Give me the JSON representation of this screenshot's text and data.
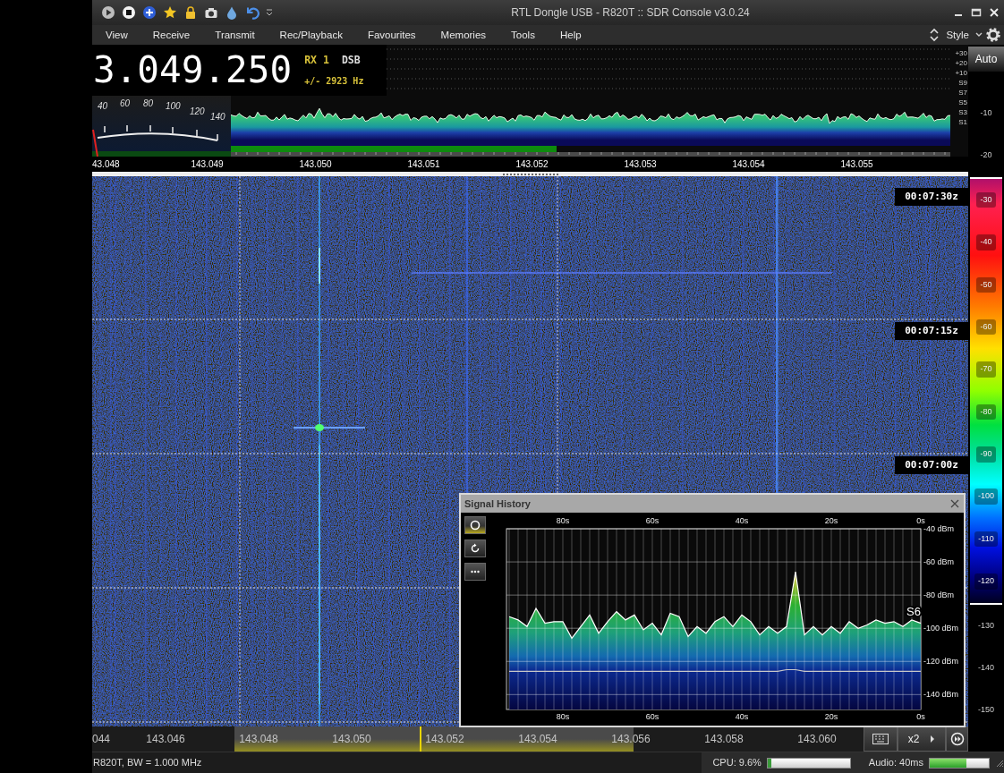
{
  "title_bar": {
    "title": "RTL Dongle USB - R820T :: SDR Console v3.0.24"
  },
  "menu": [
    "View",
    "Receive",
    "Transmit",
    "Rec/Playback",
    "Favourites",
    "Memories",
    "Tools",
    "Help"
  ],
  "style_menu": "Style",
  "frequency": {
    "value": "3.049.250",
    "receiver": "RX 1",
    "mode": "DSB",
    "bandwidth": "+/- 2923 Hz"
  },
  "s_meter": {
    "scale": [
      "40",
      "60",
      "80",
      "100",
      "120",
      "140"
    ]
  },
  "spectrum": {
    "scale_labels": [
      "+30",
      "+20",
      "+10",
      "S9",
      "S7",
      "S5",
      "S3",
      "S1"
    ]
  },
  "auto_button": "Auto",
  "frequency_axis": [
    "43.048",
    "143.049",
    "143.050",
    "143.051",
    "143.052",
    "143.053",
    "143.054",
    "143.055"
  ],
  "level_scale": [
    {
      "label": "-10",
      "kind": "plain"
    },
    {
      "label": "-20",
      "kind": "plain"
    },
    {
      "label": "-30",
      "kind": "band"
    },
    {
      "label": "-40",
      "kind": "band"
    },
    {
      "label": "-50",
      "kind": "band"
    },
    {
      "label": "-60",
      "kind": "band"
    },
    {
      "label": "-70",
      "kind": "band"
    },
    {
      "label": "-80",
      "kind": "band"
    },
    {
      "label": "-90",
      "kind": "band"
    },
    {
      "label": "-100",
      "kind": "band"
    },
    {
      "label": "-110",
      "kind": "band"
    },
    {
      "label": "-120",
      "kind": "band"
    },
    {
      "label": "-130",
      "kind": "plain"
    },
    {
      "label": "-140",
      "kind": "plain"
    },
    {
      "label": "-150",
      "kind": "plain"
    }
  ],
  "waterfall": {
    "time_marks": [
      "00:07:30z",
      "00:07:15z",
      "00:07:00z"
    ]
  },
  "signal_history": {
    "title": "Signal History",
    "level_label": "S6",
    "chart_data": {
      "type": "line",
      "grid": true,
      "x": [
        92,
        90,
        88,
        86,
        84,
        82,
        80,
        78,
        76,
        74,
        72,
        70,
        68,
        66,
        64,
        62,
        60,
        58,
        56,
        54,
        52,
        50,
        48,
        46,
        44,
        42,
        40,
        38,
        36,
        34,
        32,
        30,
        28,
        26,
        24,
        22,
        20,
        18,
        16,
        14,
        12,
        10,
        8,
        6,
        4,
        2,
        0
      ],
      "series": [
        {
          "color": "#ffffff",
          "values": [
            -93,
            -95,
            -99,
            -88,
            -97,
            -96,
            -96,
            -106,
            -99,
            -92,
            -103,
            -96,
            -90,
            -95,
            -92,
            -101,
            -97,
            -104,
            -91,
            -93,
            -105,
            -99,
            -103,
            -96,
            -93,
            -99,
            -92,
            -96,
            -104,
            -99,
            -103,
            -99,
            -66,
            -104,
            -99,
            -104,
            -99,
            -103,
            -96,
            -100,
            -98,
            -95,
            -97,
            -96,
            -99,
            -95,
            -97
          ]
        },
        {
          "color": "#c8c8c8",
          "values": [
            -126,
            -126,
            -126,
            -126,
            -126,
            -126,
            -126,
            -126,
            -126,
            -126,
            -126,
            -126,
            -126,
            -126,
            -126,
            -126,
            -126,
            -126,
            -126,
            -126,
            -126,
            -126,
            -126,
            -126,
            -126,
            -126,
            -126,
            -126,
            -126,
            -126,
            -126,
            -125,
            -125,
            -126,
            -126,
            -126,
            -126,
            -126,
            -126,
            -126,
            -126,
            -126,
            -126,
            -126,
            -126,
            -126,
            -126
          ]
        }
      ],
      "xlim": [
        92.6,
        0
      ],
      "ylim": [
        -149,
        -40
      ],
      "xticks": [
        {
          "value": 80,
          "label": "80s"
        },
        {
          "value": 60,
          "label": "60s"
        },
        {
          "value": 40,
          "label": "40s"
        },
        {
          "value": 20,
          "label": "20s"
        },
        {
          "value": 0,
          "label": "0s"
        }
      ],
      "yticks": [
        {
          "value": -40,
          "label": "-40 dBm"
        },
        {
          "value": -60,
          "label": "-60 dBm"
        },
        {
          "value": -80,
          "label": "-80 dBm"
        },
        {
          "value": -100,
          "label": "-100 dBm"
        },
        {
          "value": -120,
          "label": "-120 dBm"
        },
        {
          "value": -140,
          "label": "-140 dBm"
        }
      ]
    }
  },
  "overview_axis": [
    "044",
    "143.046",
    "143.048",
    "143.050",
    "143.052",
    "143.054",
    "143.056",
    "143.058",
    "143.060"
  ],
  "zoom_button": "x2",
  "status_bar": {
    "device": "R820T, BW = 1.000 MHz",
    "cpu": {
      "label": "CPU: 9.6%",
      "level": 0.04
    },
    "audio": {
      "label": "Audio: 40ms",
      "level": 0.62
    }
  }
}
